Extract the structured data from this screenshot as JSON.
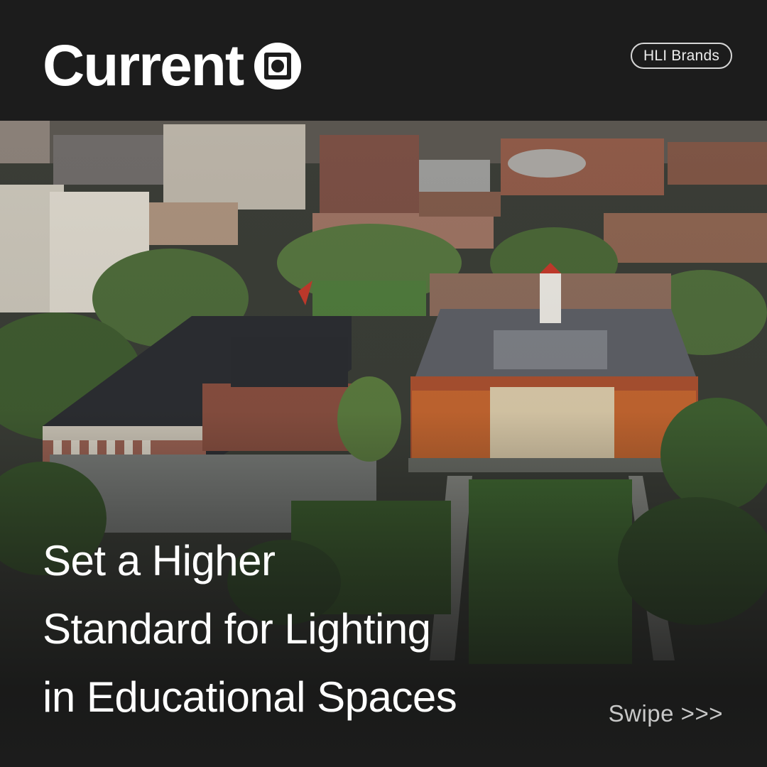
{
  "brand": {
    "name": "Current",
    "mark_icon": "square-target-logo-icon"
  },
  "badge": {
    "label": "HLI Brands"
  },
  "photo": {
    "subject": "aerial-campus-photo"
  },
  "headline": {
    "lines": [
      "Set a Higher",
      "Standard for Lighting",
      "in Educational Spaces"
    ]
  },
  "cta": {
    "label": "Swipe >>>"
  },
  "colors": {
    "background": "#1c1c1c",
    "text": "#ffffff",
    "muted": "#c8c8c8"
  }
}
